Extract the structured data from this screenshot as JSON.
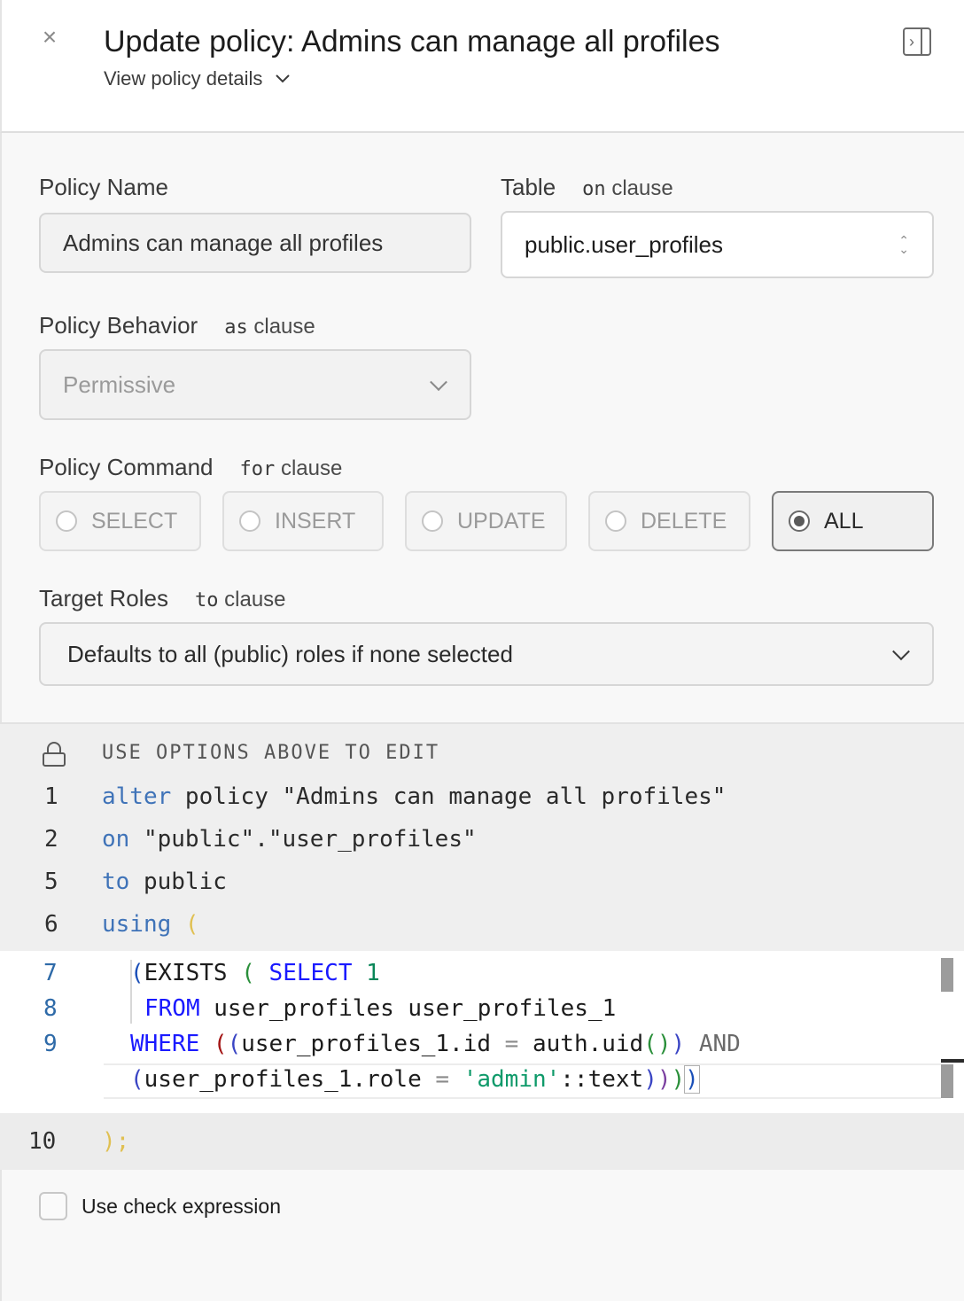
{
  "header": {
    "title": "Update policy: Admins can manage all profiles",
    "subtitle": "View policy details"
  },
  "form": {
    "policy_name": {
      "label": "Policy Name",
      "value": "Admins can manage all profiles"
    },
    "table": {
      "label": "Table",
      "clause_kw": "on",
      "clause_word": "clause",
      "value": "public.user_profiles"
    },
    "behavior": {
      "label": "Policy Behavior",
      "clause_kw": "as",
      "clause_word": "clause",
      "value": "Permissive"
    },
    "command": {
      "label": "Policy Command",
      "clause_kw": "for",
      "clause_word": "clause",
      "options": [
        "SELECT",
        "INSERT",
        "UPDATE",
        "DELETE",
        "ALL"
      ],
      "selected": "ALL"
    },
    "roles": {
      "label": "Target Roles",
      "clause_kw": "to",
      "clause_word": "clause",
      "placeholder": "Defaults to all (public) roles if none selected"
    }
  },
  "sql_preview": {
    "readonly_notice": "USE OPTIONS ABOVE TO EDIT",
    "lines": [
      {
        "num": "1",
        "kw": "alter",
        "rest": " policy \"Admins can manage all profiles\""
      },
      {
        "num": "2",
        "kw": "on",
        "rest": " \"public\".\"user_profiles\""
      },
      {
        "num": "5",
        "kw": "to",
        "rest": " public"
      },
      {
        "num": "6",
        "kw": "using",
        "rest": " ("
      }
    ],
    "end_line": {
      "num": "10",
      "text": ");"
    }
  },
  "editor": {
    "line_numbers": [
      "7",
      "8",
      "9"
    ],
    "line1": {
      "p": "(",
      "a": "EXISTS",
      "b": " ( ",
      "c": "SELECT",
      "d": " 1"
    },
    "line2": {
      "a": "FROM",
      "b": " user_profiles user_profiles_1"
    },
    "line3": {
      "a": "WHERE",
      "b": " (",
      "c": "(",
      "d": "user_profiles_1.id",
      "e": " = ",
      "f": "auth.uid",
      "g": "()",
      "h": ")",
      "i": " AND"
    },
    "line4": {
      "a": "(",
      "b": "user_profiles_1.role",
      "c": " = ",
      "d": "'admin'",
      "e": "::text",
      "f": ")",
      "g": ")",
      "h": ")",
      "i": ")"
    }
  },
  "footer": {
    "check_label": "Use check expression"
  }
}
